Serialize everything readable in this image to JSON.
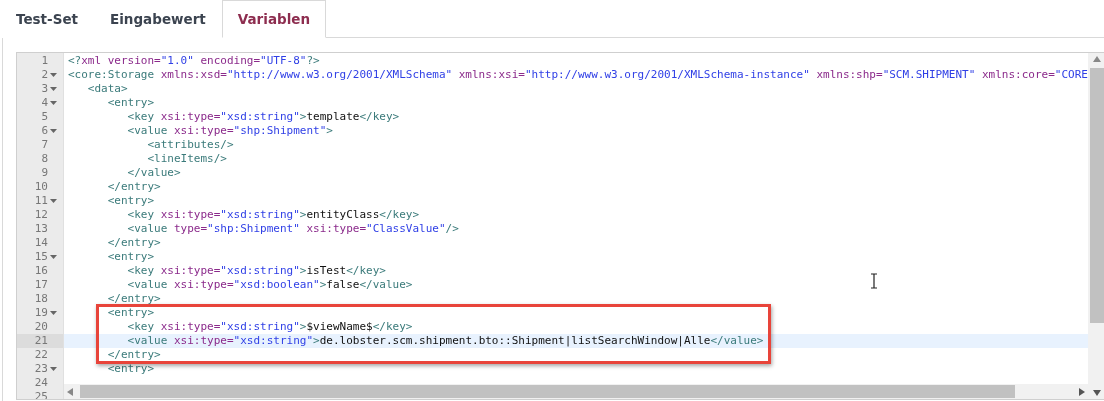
{
  "tabs": [
    {
      "label": "Test-Set",
      "selected": false
    },
    {
      "label": "Eingabewert",
      "selected": false
    },
    {
      "label": "Variablen",
      "selected": true
    }
  ],
  "editor": {
    "lines": [
      {
        "number": "1",
        "foldable": false,
        "active": false,
        "boxed": false,
        "tokens": [
          {
            "kind": "tag",
            "text": "<?"
          },
          {
            "kind": "attr",
            "text": "xml version="
          },
          {
            "kind": "string",
            "text": "\"1.0\""
          },
          {
            "kind": "attr",
            "text": " encoding="
          },
          {
            "kind": "string",
            "text": "\"UTF-8\""
          },
          {
            "kind": "tag",
            "text": "?>"
          }
        ]
      },
      {
        "number": "2",
        "foldable": true,
        "active": false,
        "boxed": false,
        "tokens": [
          {
            "kind": "tag",
            "text": "<core:Storage"
          },
          {
            "kind": "attr",
            "text": " xmlns:xsd="
          },
          {
            "kind": "string",
            "text": "\"http://www.w3.org/2001/XMLSchema\""
          },
          {
            "kind": "attr",
            "text": " xmlns:xsi="
          },
          {
            "kind": "string",
            "text": "\"http://www.w3.org/2001/XMLSchema-instance\""
          },
          {
            "kind": "attr",
            "text": " xmlns:shp="
          },
          {
            "kind": "string",
            "text": "\"SCM.SHIPMENT\""
          },
          {
            "kind": "attr",
            "text": " xmlns:core="
          },
          {
            "kind": "string",
            "text": "\"CORE"
          }
        ]
      },
      {
        "number": "3",
        "foldable": true,
        "active": false,
        "boxed": false,
        "tokens": [
          {
            "kind": "tag",
            "text": "   <data>"
          }
        ]
      },
      {
        "number": "4",
        "foldable": true,
        "active": false,
        "boxed": false,
        "tokens": [
          {
            "kind": "tag",
            "text": "      <entry>"
          }
        ]
      },
      {
        "number": "5",
        "foldable": false,
        "active": false,
        "boxed": false,
        "tokens": [
          {
            "kind": "tag",
            "text": "         <key"
          },
          {
            "kind": "attr",
            "text": " xsi:type="
          },
          {
            "kind": "string",
            "text": "\"xsd:string\""
          },
          {
            "kind": "tag",
            "text": ">"
          },
          {
            "kind": "text",
            "text": "template"
          },
          {
            "kind": "tag",
            "text": "</key>"
          }
        ]
      },
      {
        "number": "6",
        "foldable": true,
        "active": false,
        "boxed": false,
        "tokens": [
          {
            "kind": "tag",
            "text": "         <value"
          },
          {
            "kind": "attr",
            "text": " xsi:type="
          },
          {
            "kind": "string",
            "text": "\"shp:Shipment\""
          },
          {
            "kind": "tag",
            "text": ">"
          }
        ]
      },
      {
        "number": "7",
        "foldable": false,
        "active": false,
        "boxed": false,
        "tokens": [
          {
            "kind": "tag",
            "text": "            <attributes/>"
          }
        ]
      },
      {
        "number": "8",
        "foldable": false,
        "active": false,
        "boxed": false,
        "tokens": [
          {
            "kind": "tag",
            "text": "            <lineItems/>"
          }
        ]
      },
      {
        "number": "9",
        "foldable": false,
        "active": false,
        "boxed": false,
        "tokens": [
          {
            "kind": "tag",
            "text": "         </value>"
          }
        ]
      },
      {
        "number": "10",
        "foldable": false,
        "active": false,
        "boxed": false,
        "tokens": [
          {
            "kind": "tag",
            "text": "      </entry>"
          }
        ]
      },
      {
        "number": "11",
        "foldable": true,
        "active": false,
        "boxed": false,
        "tokens": [
          {
            "kind": "tag",
            "text": "      <entry>"
          }
        ]
      },
      {
        "number": "12",
        "foldable": false,
        "active": false,
        "boxed": false,
        "tokens": [
          {
            "kind": "tag",
            "text": "         <key"
          },
          {
            "kind": "attr",
            "text": " xsi:type="
          },
          {
            "kind": "string",
            "text": "\"xsd:string\""
          },
          {
            "kind": "tag",
            "text": ">"
          },
          {
            "kind": "text",
            "text": "entityClass"
          },
          {
            "kind": "tag",
            "text": "</key>"
          }
        ]
      },
      {
        "number": "13",
        "foldable": false,
        "active": false,
        "boxed": false,
        "tokens": [
          {
            "kind": "tag",
            "text": "         <value"
          },
          {
            "kind": "attr",
            "text": " type="
          },
          {
            "kind": "string",
            "text": "\"shp:Shipment\""
          },
          {
            "kind": "attr",
            "text": " xsi:type="
          },
          {
            "kind": "string",
            "text": "\"ClassValue\""
          },
          {
            "kind": "tag",
            "text": "/>"
          }
        ]
      },
      {
        "number": "14",
        "foldable": false,
        "active": false,
        "boxed": false,
        "tokens": [
          {
            "kind": "tag",
            "text": "      </entry>"
          }
        ]
      },
      {
        "number": "15",
        "foldable": true,
        "active": false,
        "boxed": false,
        "tokens": [
          {
            "kind": "tag",
            "text": "      <entry>"
          }
        ]
      },
      {
        "number": "16",
        "foldable": false,
        "active": false,
        "boxed": false,
        "tokens": [
          {
            "kind": "tag",
            "text": "         <key"
          },
          {
            "kind": "attr",
            "text": " xsi:type="
          },
          {
            "kind": "string",
            "text": "\"xsd:string\""
          },
          {
            "kind": "tag",
            "text": ">"
          },
          {
            "kind": "text",
            "text": "isTest"
          },
          {
            "kind": "tag",
            "text": "</key>"
          }
        ]
      },
      {
        "number": "17",
        "foldable": false,
        "active": false,
        "boxed": false,
        "tokens": [
          {
            "kind": "tag",
            "text": "         <value"
          },
          {
            "kind": "attr",
            "text": " xsi:type="
          },
          {
            "kind": "string",
            "text": "\"xsd:boolean\""
          },
          {
            "kind": "tag",
            "text": ">"
          },
          {
            "kind": "text",
            "text": "false"
          },
          {
            "kind": "tag",
            "text": "</value>"
          }
        ]
      },
      {
        "number": "18",
        "foldable": false,
        "active": false,
        "boxed": false,
        "tokens": [
          {
            "kind": "tag",
            "text": "      </entry>"
          }
        ]
      },
      {
        "number": "19",
        "foldable": true,
        "active": false,
        "boxed": true,
        "tokens": [
          {
            "kind": "tag",
            "text": "      <entry>"
          }
        ]
      },
      {
        "number": "20",
        "foldable": false,
        "active": false,
        "boxed": true,
        "tokens": [
          {
            "kind": "tag",
            "text": "         <key"
          },
          {
            "kind": "attr",
            "text": " xsi:type="
          },
          {
            "kind": "string",
            "text": "\"xsd:string\""
          },
          {
            "kind": "tag",
            "text": ">"
          },
          {
            "kind": "text",
            "text": "$viewName$"
          },
          {
            "kind": "tag",
            "text": "</key>"
          }
        ]
      },
      {
        "number": "21",
        "foldable": false,
        "active": true,
        "boxed": true,
        "tokens": [
          {
            "kind": "tag",
            "text": "         <value"
          },
          {
            "kind": "attr",
            "text": " xsi:type="
          },
          {
            "kind": "string",
            "text": "\"xsd:string\""
          },
          {
            "kind": "tag",
            "text": ">"
          },
          {
            "kind": "text",
            "text": "de.lobster.scm.shipment.bto::Shipment|listSearchWindow|Alle"
          },
          {
            "kind": "tag",
            "text": "</value>"
          }
        ]
      },
      {
        "number": "22",
        "foldable": false,
        "active": false,
        "boxed": true,
        "tokens": [
          {
            "kind": "tag",
            "text": "      </entry>"
          }
        ]
      },
      {
        "number": "23",
        "foldable": true,
        "active": false,
        "boxed": false,
        "tokens": [
          {
            "kind": "tag",
            "text": "      <entry>"
          }
        ]
      },
      {
        "number": "24",
        "foldable": false,
        "active": false,
        "boxed": false
      },
      {
        "number": "25",
        "foldable": false,
        "active": false,
        "boxed": false
      }
    ]
  }
}
